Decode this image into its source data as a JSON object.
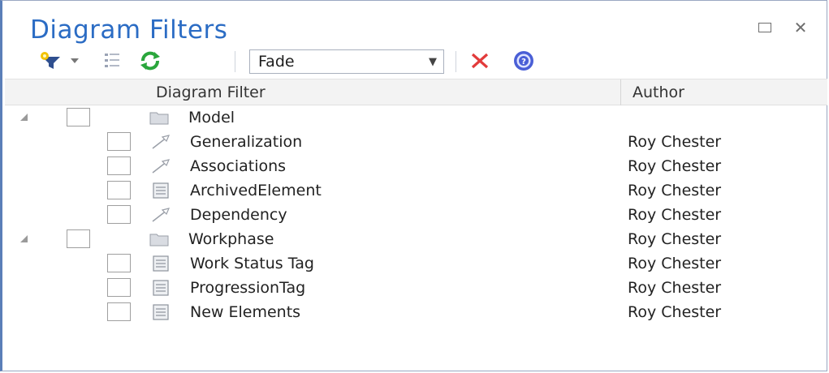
{
  "window": {
    "title": "Diagram Filters"
  },
  "toolbar": {
    "mode_combo_value": "Fade"
  },
  "columns": {
    "filter": "Diagram Filter",
    "author": "Author"
  },
  "rows": [
    {
      "label": "Model",
      "author": "",
      "icon": "folder-icon",
      "level": 0
    },
    {
      "label": "Generalization",
      "author": "Roy Chester",
      "icon": "connector-icon",
      "level": 1
    },
    {
      "label": "Associations",
      "author": "Roy Chester",
      "icon": "connector-icon",
      "level": 1
    },
    {
      "label": "ArchivedElement",
      "author": "Roy Chester",
      "icon": "filter-document-icon",
      "level": 1
    },
    {
      "label": "Dependency",
      "author": "Roy Chester",
      "icon": "connector-icon",
      "level": 1
    },
    {
      "label": "Workphase",
      "author": "Roy Chester",
      "icon": "folder-icon",
      "level": 0
    },
    {
      "label": "Work Status Tag",
      "author": "Roy Chester",
      "icon": "filter-document-icon",
      "level": 1
    },
    {
      "label": "ProgressionTag",
      "author": "Roy Chester",
      "icon": "filter-document-icon",
      "level": 1
    },
    {
      "label": "New Elements",
      "author": "Roy Chester",
      "icon": "filter-document-icon",
      "level": 1
    }
  ],
  "colors": {
    "title": "#2b6cc4",
    "delete": "#e23b3b",
    "refresh": "#2aa63c",
    "help": "#4a5fd6"
  }
}
